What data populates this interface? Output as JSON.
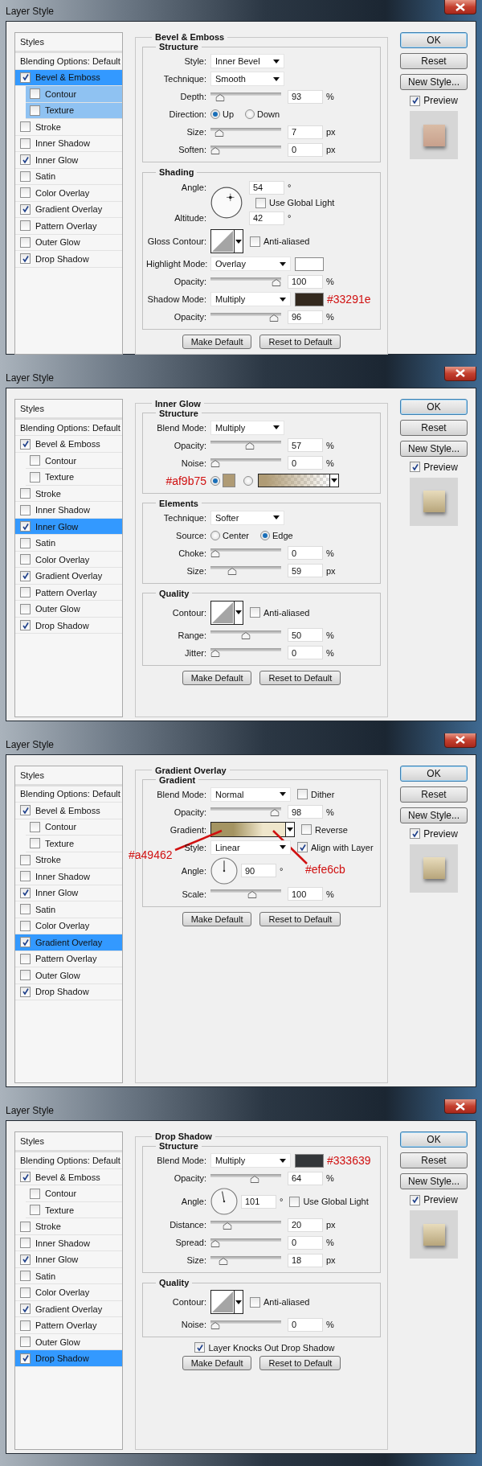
{
  "dialogs": [
    {
      "title": "Layer Style",
      "styles": {
        "header": "Styles",
        "items": [
          {
            "kind": "option",
            "label": "Blending Options: Default",
            "selected": false
          },
          {
            "kind": "effect",
            "label": "Bevel & Emboss",
            "checked": true,
            "selected": true,
            "children": [
              {
                "kind": "effect",
                "label": "Contour",
                "checked": false,
                "selected": false
              },
              {
                "kind": "effect",
                "label": "Texture",
                "checked": false,
                "selected": false
              }
            ]
          },
          {
            "kind": "effect",
            "label": "Stroke",
            "checked": false,
            "selected": false
          },
          {
            "kind": "effect",
            "label": "Inner Shadow",
            "checked": false,
            "selected": false
          },
          {
            "kind": "effect",
            "label": "Inner Glow",
            "checked": true,
            "selected": false
          },
          {
            "kind": "effect",
            "label": "Satin",
            "checked": false,
            "selected": false
          },
          {
            "kind": "effect",
            "label": "Color Overlay",
            "checked": false,
            "selected": false
          },
          {
            "kind": "effect",
            "label": "Gradient Overlay",
            "checked": true,
            "selected": false
          },
          {
            "kind": "effect",
            "label": "Pattern Overlay",
            "checked": false,
            "selected": false
          },
          {
            "kind": "effect",
            "label": "Outer Glow",
            "checked": false,
            "selected": false
          },
          {
            "kind": "effect",
            "label": "Drop Shadow",
            "checked": true,
            "selected": false
          }
        ]
      },
      "panel": {
        "title": "Bevel & Emboss",
        "sections": [
          {
            "title": "Structure",
            "rows": [
              {
                "kind": "dropdown",
                "label": "Style:",
                "value": "Inner Bevel"
              },
              {
                "kind": "dropdown",
                "label": "Technique:",
                "value": "Smooth"
              },
              {
                "kind": "slider",
                "label": "Depth:",
                "level": 0.08,
                "value": "93",
                "unit": "%"
              },
              {
                "kind": "radio",
                "label": "Direction:",
                "options": [
                  {
                    "label": "Up",
                    "selected": true
                  },
                  {
                    "label": "Down",
                    "selected": false
                  }
                ]
              },
              {
                "kind": "slider",
                "label": "Size:",
                "level": 0.06,
                "value": "7",
                "unit": "px"
              },
              {
                "kind": "slider",
                "label": "Soften:",
                "level": 0,
                "value": "0",
                "unit": "px"
              }
            ]
          },
          {
            "title": "Shading",
            "rows": [
              {
                "kind": "shading_angle",
                "label": "Angle:",
                "value": "54",
                "unit": "°",
                "checkbox": {
                  "label": "Use Global Light",
                  "checked": false
                },
                "altitude_label": "Altitude:",
                "altitude": "42",
                "altitude_unit": "°"
              },
              {
                "kind": "contour",
                "label": "Gloss Contour:",
                "checkbox": {
                  "label": "Anti-aliased",
                  "checked": false
                }
              },
              {
                "kind": "dropdown",
                "label": "Highlight Mode:",
                "value": "Overlay",
                "swatch": {
                  "color": "#ffffff"
                }
              },
              {
                "kind": "slider",
                "label": "Opacity:",
                "level": 1,
                "value": "100",
                "unit": "%"
              },
              {
                "kind": "dropdown",
                "label": "Shadow Mode:",
                "value": "Multiply",
                "swatch": {
                  "color": "#33291e",
                  "note": "#33291e"
                }
              },
              {
                "kind": "slider",
                "label": "Opacity:",
                "level": 0.96,
                "value": "96",
                "unit": "%"
              }
            ]
          }
        ],
        "buttons": [
          "Make Default",
          "Reset to Default"
        ]
      },
      "buttons": [
        "OK",
        "Reset",
        "New Style..."
      ],
      "preview": {
        "label": "Preview",
        "checked": true
      }
    },
    {
      "title": "Layer Style",
      "styles": {
        "header": "Styles",
        "items": [
          {
            "kind": "option",
            "label": "Blending Options: Default",
            "selected": false
          },
          {
            "kind": "effect",
            "label": "Bevel & Emboss",
            "checked": true,
            "selected": false,
            "children": [
              {
                "kind": "effect",
                "label": "Contour",
                "checked": false,
                "selected": false
              },
              {
                "kind": "effect",
                "label": "Texture",
                "checked": false,
                "selected": false
              }
            ]
          },
          {
            "kind": "effect",
            "label": "Stroke",
            "checked": false,
            "selected": false
          },
          {
            "kind": "effect",
            "label": "Inner Shadow",
            "checked": false,
            "selected": false
          },
          {
            "kind": "effect",
            "label": "Inner Glow",
            "checked": true,
            "selected": true
          },
          {
            "kind": "effect",
            "label": "Satin",
            "checked": false,
            "selected": false
          },
          {
            "kind": "effect",
            "label": "Color Overlay",
            "checked": false,
            "selected": false
          },
          {
            "kind": "effect",
            "label": "Gradient Overlay",
            "checked": true,
            "selected": false
          },
          {
            "kind": "effect",
            "label": "Pattern Overlay",
            "checked": false,
            "selected": false
          },
          {
            "kind": "effect",
            "label": "Outer Glow",
            "checked": false,
            "selected": false
          },
          {
            "kind": "effect",
            "label": "Drop Shadow",
            "checked": true,
            "selected": false
          }
        ]
      },
      "panel": {
        "title": "Inner Glow",
        "sections": [
          {
            "title": "Structure",
            "rows": [
              {
                "kind": "dropdown",
                "label": "Blend Mode:",
                "value": "Multiply"
              },
              {
                "kind": "slider",
                "label": "Opacity:",
                "level": 0.57,
                "value": "57",
                "unit": "%"
              },
              {
                "kind": "slider",
                "label": "Noise:",
                "level": 0,
                "value": "0",
                "unit": "%"
              },
              {
                "kind": "glow_source",
                "note": "#af9b75",
                "options": [
                  {
                    "kind": "solid",
                    "selected": true,
                    "color": "#af9b75"
                  },
                  {
                    "kind": "gradient",
                    "selected": false,
                    "color": "#af9b75"
                  }
                ]
              }
            ]
          },
          {
            "title": "Elements",
            "rows": [
              {
                "kind": "dropdown",
                "label": "Technique:",
                "value": "Softer"
              },
              {
                "kind": "radio",
                "label": "Source:",
                "options": [
                  {
                    "label": "Center",
                    "selected": false
                  },
                  {
                    "label": "Edge",
                    "selected": true
                  }
                ]
              },
              {
                "kind": "slider",
                "label": "Choke:",
                "level": 0,
                "value": "0",
                "unit": "%"
              },
              {
                "kind": "slider",
                "label": "Size:",
                "level": 0.28,
                "value": "59",
                "unit": "px"
              }
            ]
          },
          {
            "title": "Quality",
            "rows": [
              {
                "kind": "contour",
                "label": "Contour:",
                "checkbox": {
                  "label": "Anti-aliased",
                  "checked": false
                }
              },
              {
                "kind": "slider",
                "label": "Range:",
                "level": 0.5,
                "value": "50",
                "unit": "%"
              },
              {
                "kind": "slider",
                "label": "Jitter:",
                "level": 0,
                "value": "0",
                "unit": "%"
              }
            ]
          }
        ],
        "buttons": [
          "Make Default",
          "Reset to Default"
        ]
      },
      "buttons": [
        "OK",
        "Reset",
        "New Style..."
      ],
      "preview": {
        "label": "Preview",
        "checked": true
      }
    },
    {
      "title": "Layer Style",
      "styles": {
        "header": "Styles",
        "items": [
          {
            "kind": "option",
            "label": "Blending Options: Default",
            "selected": false
          },
          {
            "kind": "effect",
            "label": "Bevel & Emboss",
            "checked": true,
            "selected": false,
            "children": [
              {
                "kind": "effect",
                "label": "Contour",
                "checked": false,
                "selected": false
              },
              {
                "kind": "effect",
                "label": "Texture",
                "checked": false,
                "selected": false
              }
            ]
          },
          {
            "kind": "effect",
            "label": "Stroke",
            "checked": false,
            "selected": false
          },
          {
            "kind": "effect",
            "label": "Inner Shadow",
            "checked": false,
            "selected": false
          },
          {
            "kind": "effect",
            "label": "Inner Glow",
            "checked": true,
            "selected": false
          },
          {
            "kind": "effect",
            "label": "Satin",
            "checked": false,
            "selected": false
          },
          {
            "kind": "effect",
            "label": "Color Overlay",
            "checked": false,
            "selected": false
          },
          {
            "kind": "effect",
            "label": "Gradient Overlay",
            "checked": true,
            "selected": true
          },
          {
            "kind": "effect",
            "label": "Pattern Overlay",
            "checked": false,
            "selected": false
          },
          {
            "kind": "effect",
            "label": "Outer Glow",
            "checked": false,
            "selected": false
          },
          {
            "kind": "effect",
            "label": "Drop Shadow",
            "checked": true,
            "selected": false
          }
        ]
      },
      "panel": {
        "title": "Gradient Overlay",
        "sections": [
          {
            "title": "Gradient",
            "rows": [
              {
                "kind": "dropdown",
                "label": "Blend Mode:",
                "value": "Normal",
                "checkbox": {
                  "label": "Dither",
                  "checked": false
                }
              },
              {
                "kind": "slider",
                "label": "Opacity:",
                "level": 0.98,
                "value": "98",
                "unit": "%"
              },
              {
                "kind": "gradient",
                "label": "Gradient:",
                "from": {
                  "color": "#a49462",
                  "note": "#a49462"
                },
                "to": {
                  "color": "#efe6cb",
                  "note": "#efe6cb"
                },
                "checkbox": {
                  "label": "Reverse",
                  "checked": false
                }
              },
              {
                "kind": "dropdown",
                "label": "Style:",
                "value": "Linear",
                "checkbox": {
                  "label": "Align with Layer",
                  "checked": true
                }
              },
              {
                "kind": "angle",
                "label": "Angle:",
                "value": "90",
                "unit": "°"
              },
              {
                "kind": "slider",
                "label": "Scale:",
                "level": 0.61,
                "value": "100",
                "unit": "%"
              }
            ]
          }
        ],
        "buttons": [
          "Make Default",
          "Reset to Default"
        ]
      },
      "buttons": [
        "OK",
        "Reset",
        "New Style..."
      ],
      "preview": {
        "label": "Preview",
        "checked": true
      }
    },
    {
      "title": "Layer Style",
      "styles": {
        "header": "Styles",
        "items": [
          {
            "kind": "option",
            "label": "Blending Options: Default",
            "selected": false
          },
          {
            "kind": "effect",
            "label": "Bevel & Emboss",
            "checked": true,
            "selected": false,
            "children": [
              {
                "kind": "effect",
                "label": "Contour",
                "checked": false,
                "selected": false
              },
              {
                "kind": "effect",
                "label": "Texture",
                "checked": false,
                "selected": false
              }
            ]
          },
          {
            "kind": "effect",
            "label": "Stroke",
            "checked": false,
            "selected": false
          },
          {
            "kind": "effect",
            "label": "Inner Shadow",
            "checked": false,
            "selected": false
          },
          {
            "kind": "effect",
            "label": "Inner Glow",
            "checked": true,
            "selected": false
          },
          {
            "kind": "effect",
            "label": "Satin",
            "checked": false,
            "selected": false
          },
          {
            "kind": "effect",
            "label": "Color Overlay",
            "checked": false,
            "selected": false
          },
          {
            "kind": "effect",
            "label": "Gradient Overlay",
            "checked": true,
            "selected": false
          },
          {
            "kind": "effect",
            "label": "Pattern Overlay",
            "checked": false,
            "selected": false
          },
          {
            "kind": "effect",
            "label": "Outer Glow",
            "checked": false,
            "selected": false
          },
          {
            "kind": "effect",
            "label": "Drop Shadow",
            "checked": true,
            "selected": true
          }
        ]
      },
      "panel": {
        "title": "Drop Shadow",
        "sections": [
          {
            "title": "Structure",
            "rows": [
              {
                "kind": "dropdown",
                "label": "Blend Mode:",
                "value": "Multiply",
                "swatch": {
                  "color": "#333639",
                  "note": "#333639"
                }
              },
              {
                "kind": "slider",
                "label": "Opacity:",
                "level": 0.64,
                "value": "64",
                "unit": "%"
              },
              {
                "kind": "angle",
                "label": "Angle:",
                "value": "101",
                "unit": "°",
                "checkbox": {
                  "label": "Use Global Light",
                  "checked": false
                }
              },
              {
                "kind": "slider",
                "label": "Distance:",
                "level": 0.2,
                "value": "20",
                "unit": "px"
              },
              {
                "kind": "slider",
                "label": "Spread:",
                "level": 0,
                "value": "0",
                "unit": "%"
              },
              {
                "kind": "slider",
                "label": "Size:",
                "level": 0.13,
                "value": "18",
                "unit": "px"
              }
            ]
          },
          {
            "title": "Quality",
            "rows": [
              {
                "kind": "contour",
                "label": "Contour:",
                "checkbox": {
                  "label": "Anti-aliased",
                  "checked": false
                }
              },
              {
                "kind": "slider",
                "label": "Noise:",
                "level": 0,
                "value": "0",
                "unit": "%"
              }
            ]
          }
        ],
        "footer_checkbox": {
          "label": "Layer Knocks Out Drop Shadow",
          "checked": true
        },
        "buttons": [
          "Make Default",
          "Reset to Default"
        ]
      },
      "buttons": [
        "OK",
        "Reset",
        "New Style..."
      ],
      "preview": {
        "label": "Preview",
        "checked": true
      }
    }
  ]
}
